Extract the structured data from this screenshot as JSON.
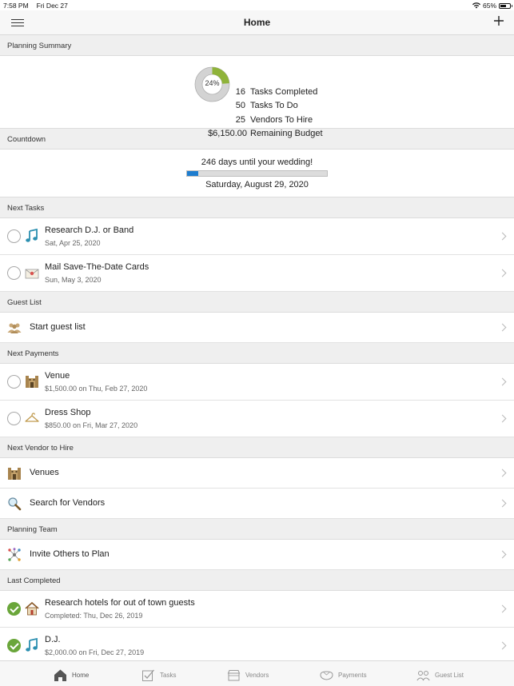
{
  "status_bar": {
    "time": "7:58 PM",
    "date": "Fri Dec 27",
    "battery": "65%",
    "battery_level": 0.65
  },
  "nav": {
    "title": "Home"
  },
  "sections": {
    "planning_summary": "Planning Summary",
    "countdown": "Countdown",
    "next_tasks": "Next Tasks",
    "guest_list": "Guest List",
    "next_payments": "Next Payments",
    "next_vendor": "Next Vendor to Hire",
    "planning_team": "Planning Team",
    "last_completed": "Last Completed"
  },
  "summary": {
    "percent_label": "24%",
    "percent": 0.24,
    "stats": [
      {
        "value": "16",
        "label": "Tasks Completed"
      },
      {
        "value": "50",
        "label": "Tasks To Do"
      },
      {
        "value": "25",
        "label": "Vendors To Hire"
      },
      {
        "value": "$6,150.00",
        "label": "Remaining Budget"
      }
    ]
  },
  "countdown": {
    "days_text": "246 days until your wedding!",
    "progress": 0.08,
    "date": "Saturday, August 29, 2020"
  },
  "next_tasks": [
    {
      "title": "Research D.J. or Band",
      "sub": "Sat, Apr 25, 2020",
      "icon": "music-note-icon"
    },
    {
      "title": "Mail Save-The-Date Cards",
      "sub": "Sun, May 3, 2020",
      "icon": "envelope-icon"
    }
  ],
  "guest_list": {
    "label": "Start guest list",
    "icon": "guests-icon"
  },
  "next_payments": [
    {
      "title": "Venue",
      "sub": "$1,500.00 on Thu, Feb 27, 2020",
      "icon": "venue-icon"
    },
    {
      "title": "Dress Shop",
      "sub": "$850.00 on Fri, Mar 27, 2020",
      "icon": "hanger-icon"
    }
  ],
  "next_vendor": [
    {
      "label": "Venues",
      "icon": "venue-icon"
    },
    {
      "label": "Search for Vendors",
      "icon": "magnifier-icon"
    }
  ],
  "planning_team": {
    "label": "Invite Others to Plan",
    "icon": "network-icon"
  },
  "last_completed": [
    {
      "title": "Research hotels for out of town guests",
      "sub": "Completed: Thu, Dec 26, 2019",
      "icon": "house-icon"
    },
    {
      "title": "D.J.",
      "sub": "$2,000.00 on Fri, Dec 27, 2019",
      "icon": "music-note-icon"
    }
  ],
  "tabs": [
    {
      "label": "Home",
      "icon": "home-icon"
    },
    {
      "label": "Tasks",
      "icon": "checklist-icon"
    },
    {
      "label": "Vendors",
      "icon": "vendors-icon"
    },
    {
      "label": "Payments",
      "icon": "payments-icon"
    },
    {
      "label": "Guest List",
      "icon": "guest-list-icon"
    }
  ],
  "colors": {
    "accent": "#1e7dcf",
    "donut_fill": "#8fb33a",
    "donut_track": "#d3d3d3",
    "check": "#6aa63a"
  }
}
